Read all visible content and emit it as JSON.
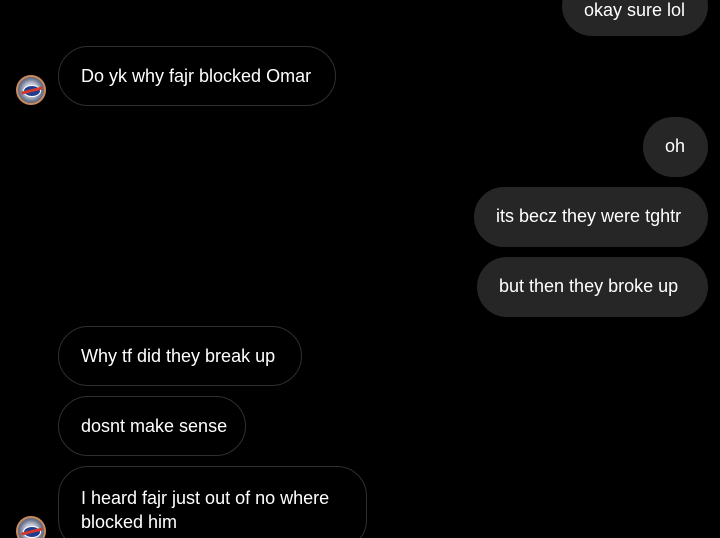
{
  "conversation": {
    "messages": [
      {
        "id": "m1",
        "direction": "outgoing",
        "text": "okay sure lol"
      },
      {
        "id": "m2",
        "direction": "incoming",
        "text": "Do yk why fajr blocked Omar"
      },
      {
        "id": "m3",
        "direction": "outgoing",
        "text": "oh"
      },
      {
        "id": "m4",
        "direction": "outgoing",
        "text": "its becz they were tghtr"
      },
      {
        "id": "m5",
        "direction": "outgoing",
        "text": "but then they broke up"
      },
      {
        "id": "m6",
        "direction": "incoming",
        "text": "Why tf did they break up"
      },
      {
        "id": "m7",
        "direction": "incoming",
        "text": "dosnt make sense"
      },
      {
        "id": "m8",
        "direction": "incoming",
        "text": "I heard fajr just out of no where"
      },
      {
        "id": "m9",
        "direction": "incoming",
        "text": "blocked him"
      }
    ]
  },
  "contact": {
    "avatar_icon": "nasa-logo-avatar-icon"
  },
  "colors": {
    "background": "#000000",
    "outgoing_bubble": "#262626",
    "incoming_border": "#2f2f2f",
    "text": "#ffffff"
  }
}
